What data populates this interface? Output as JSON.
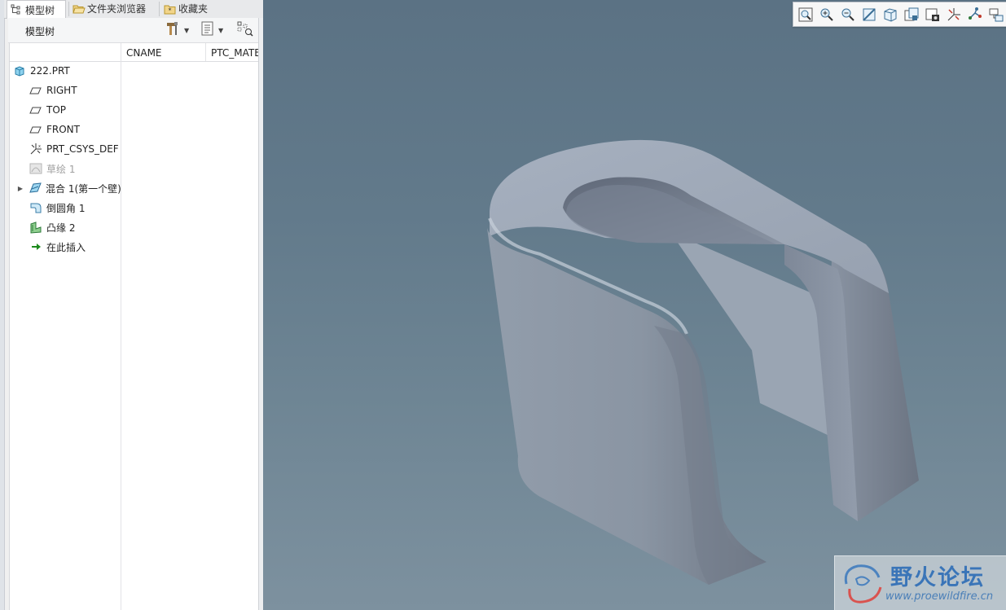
{
  "tabs": [
    {
      "label": "模型树",
      "icon": "model-tree-icon"
    },
    {
      "label": "文件夹浏览器",
      "icon": "folder-browser-icon"
    },
    {
      "label": "收藏夹",
      "icon": "favorites-icon"
    }
  ],
  "panel": {
    "title": "模型树"
  },
  "columns": [
    "CNAME",
    "PTC_MATE"
  ],
  "tree": [
    {
      "label": "222.PRT",
      "icon": "part-icon"
    },
    {
      "label": "RIGHT",
      "icon": "datum-plane-icon"
    },
    {
      "label": "TOP",
      "icon": "datum-plane-icon"
    },
    {
      "label": "FRONT",
      "icon": "datum-plane-icon"
    },
    {
      "label": "PRT_CSYS_DEF",
      "icon": "coordinate-system-icon"
    },
    {
      "label": "草绘 1",
      "icon": "sketch-icon"
    },
    {
      "label": "混合 1(第一个壁)",
      "icon": "blend-wall-icon"
    },
    {
      "label": "倒圆角 1",
      "icon": "round-icon"
    },
    {
      "label": "凸缘 2",
      "icon": "flange-icon"
    },
    {
      "label": "在此插入",
      "icon": "insert-here-icon"
    }
  ],
  "watermark": {
    "cn": "野火论坛",
    "en": "www.proewildfire.cn"
  },
  "colors": {
    "viewport_top": "#5b7284",
    "viewport_bottom": "#7d919f",
    "part": "#9aa3b2",
    "insert_green": "#1c8a1c"
  }
}
